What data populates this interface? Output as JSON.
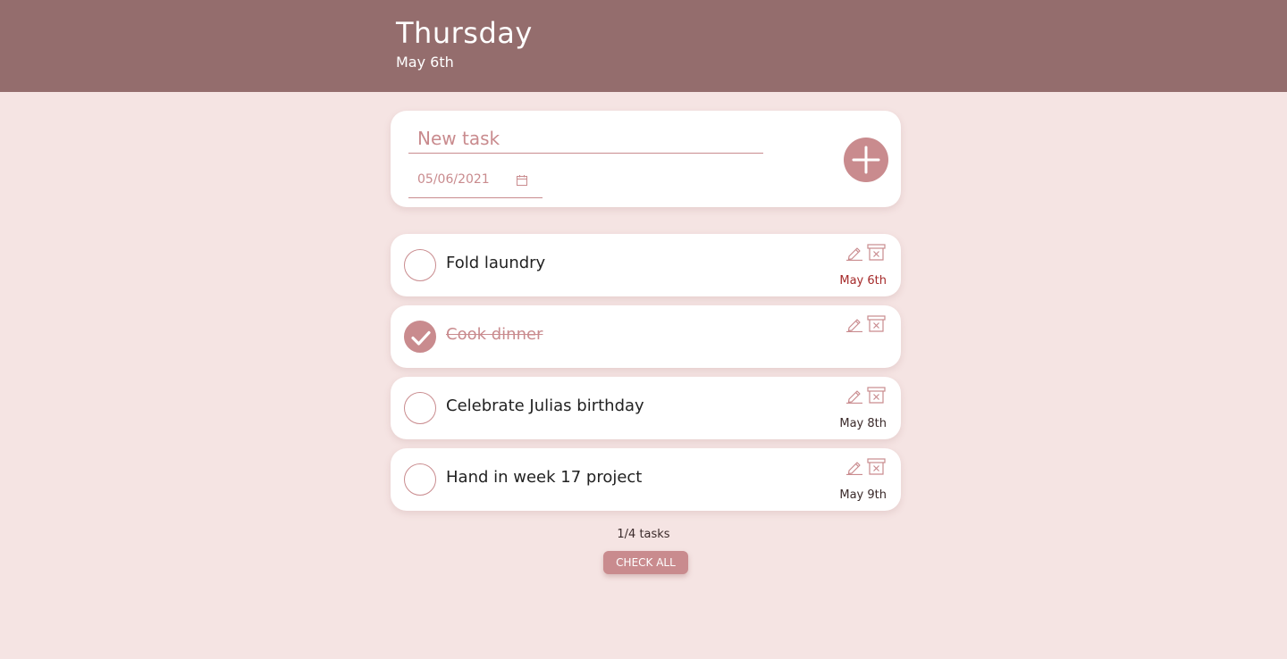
{
  "header": {
    "day": "Thursday",
    "date": "May 6th"
  },
  "new_task": {
    "placeholder": "New task",
    "date_value": "05/06/2021",
    "add_icon": "plus-icon"
  },
  "tasks": [
    {
      "text": "Fold laundry",
      "done": false,
      "due": "May 6th",
      "due_today": true
    },
    {
      "text": "Cook dinner",
      "done": true,
      "due": "",
      "due_today": false
    },
    {
      "text": "Celebrate Julias birthday",
      "done": false,
      "due": "May 8th",
      "due_today": false
    },
    {
      "text": "Hand in week 17 project",
      "done": false,
      "due": "May 9th",
      "due_today": false
    }
  ],
  "footer": {
    "count": "1/4 tasks",
    "check_all_label": "CHECK ALL"
  },
  "colors": {
    "header": "#946d6d",
    "background": "#f5e4e3",
    "accent": "#c98b8e",
    "today_due": "#a52a2a"
  }
}
